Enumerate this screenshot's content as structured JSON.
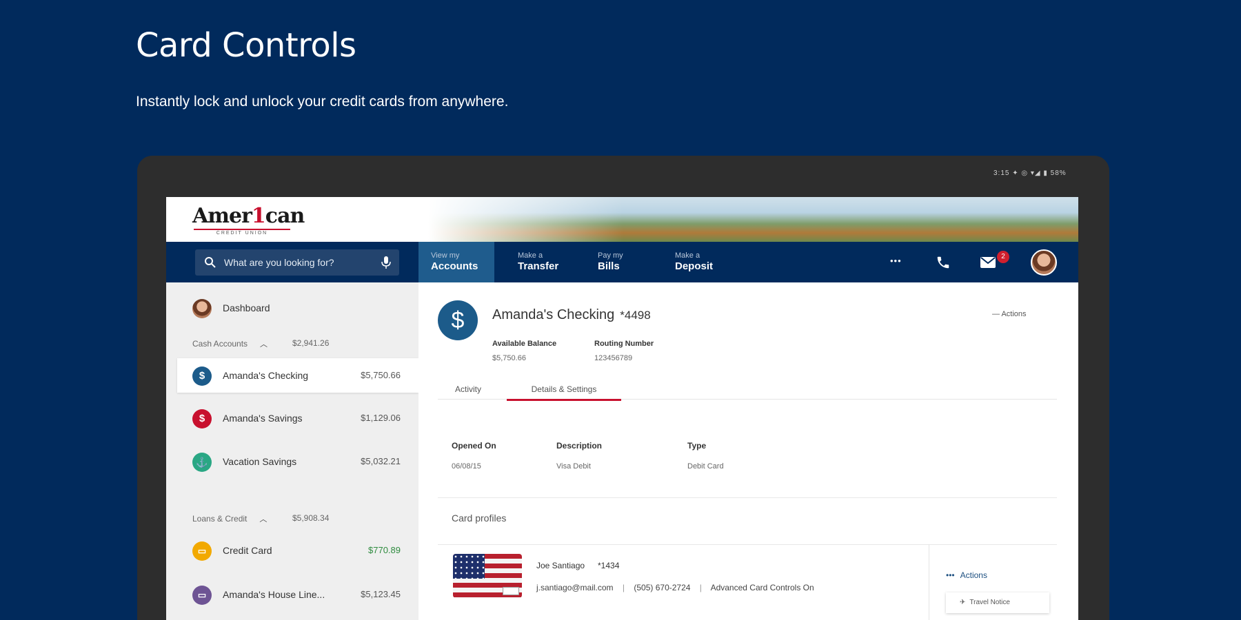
{
  "promo": {
    "title": "Card Controls",
    "subtitle": "Instantly lock and unlock your credit cards from anywhere."
  },
  "device": {
    "status_bar": "3:15 ✦ ◎ ▾◢ ▮ 58%"
  },
  "brand": {
    "logo_pre": "Amer",
    "logo_one": "1",
    "logo_post": "can",
    "logo_sub": "CREDIT UNION"
  },
  "nav": {
    "search_placeholder": "What are you looking for?",
    "items": [
      {
        "small": "View my",
        "big": "Accounts"
      },
      {
        "small": "Make a",
        "big": "Transfer"
      },
      {
        "small": "Pay my",
        "big": "Bills"
      },
      {
        "small": "Make a",
        "big": "Deposit"
      }
    ],
    "more": "•••",
    "mail_badge": "2"
  },
  "sidebar": {
    "dashboard": "Dashboard",
    "cash_header": "Cash Accounts",
    "cash_total": "$2,941.26",
    "loans_header": "Loans & Credit",
    "loans_total": "$5,908.34",
    "accounts": [
      {
        "name": "Amanda's Checking",
        "amount": "$5,750.66",
        "icon": "$",
        "color": "#1c5b8a"
      },
      {
        "name": "Amanda's Savings",
        "amount": "$1,129.06",
        "icon": "$",
        "color": "#c8102e"
      },
      {
        "name": "Vacation Savings",
        "amount": "$5,032.21",
        "icon": "⚓",
        "color": "#2aa784"
      }
    ],
    "loans": [
      {
        "name": "Credit Card",
        "amount": "$770.89",
        "icon": "▭",
        "color": "#f2a900",
        "amount_color": "#2e8b3e"
      },
      {
        "name": "Amanda's House Line...",
        "amount": "$5,123.45",
        "icon": "▭",
        "color": "#6e5494",
        "amount_color": "#555555"
      }
    ]
  },
  "account": {
    "icon": "$",
    "title": "Amanda's Checking",
    "number": "*4498",
    "actions": "—  Actions",
    "available_balance_label": "Available Balance",
    "available_balance_value": "$5,750.66",
    "routing_label": "Routing Number",
    "routing_value": "123456789"
  },
  "tabs": {
    "activity": "Activity",
    "details": "Details & Settings"
  },
  "details": {
    "opened_label": "Opened On",
    "opened_value": "06/08/15",
    "description_label": "Description",
    "description_value": "Visa Debit",
    "type_label": "Type",
    "type_value": "Debit Card"
  },
  "card_profiles": {
    "title": "Card profiles",
    "holder": "Joe Santiago",
    "last4": "*1434",
    "email": "j.santiago@mail.com",
    "phone": "(505) 670-2724",
    "controls": "Advanced Card Controls On",
    "actions": "Actions",
    "travel_notice": "Travel Notice"
  }
}
